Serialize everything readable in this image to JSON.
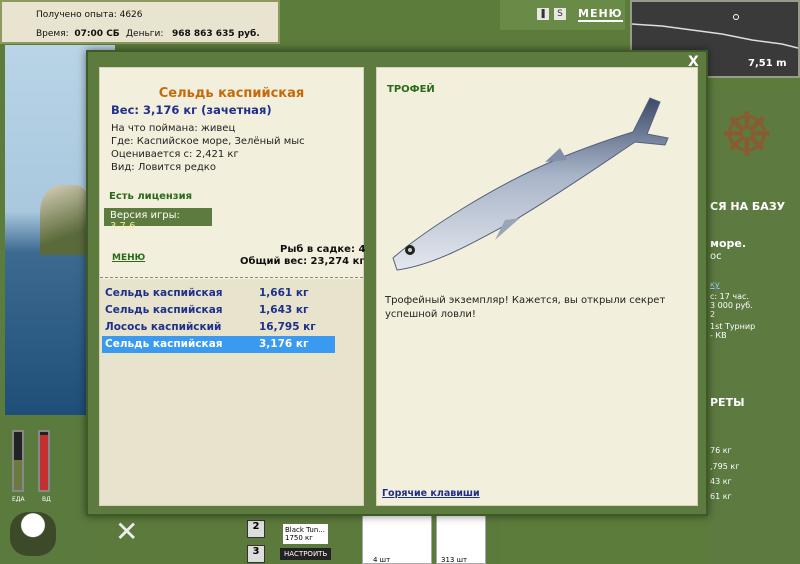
{
  "hud": {
    "experience": "Получено опыта: 4626",
    "time_label": "Время:",
    "time_value": "07:00 СБ",
    "money_label": "Деньги:",
    "money_value": "968 863 635 руб.",
    "menu": "МЕНЮ",
    "depth": "7,51 m",
    "eda": "ЕДА",
    "vd": "ВД"
  },
  "background": {
    "to_base": "СЯ НА БАЗУ",
    "sea_title": "море.",
    "sea_sub": "ос",
    "link": "ку",
    "lines": [
      "с: 17 час.",
      "3 000 руб.",
      "2",
      "1st Турнир",
      "- КВ"
    ],
    "secrets": "РЕТЫ",
    "weights": [
      "76 кг",
      ",795 кг",
      "43 кг",
      "61 кг"
    ],
    "bottom_fish": "Black Tun...",
    "bottom_weight": "1750 кг",
    "bottom_button": "НАСТРОИТЬ",
    "slot_numbers": [
      "2",
      "3"
    ],
    "counts": [
      "4 шт",
      "313 шт"
    ]
  },
  "dialog": {
    "close": "X",
    "fish_name": "Сельдь каспийская",
    "weight": "Вес: 3,176 кг (зачетная)",
    "caught_on": "На что поймана: живец",
    "location": "Где: Каспийское море, Зелёный мыс",
    "price": "Оценивается с: 2,421 кг",
    "kind": "Вид: Ловится редко",
    "license": "Есть лицензия",
    "version_label": "Версия игры:",
    "version_value": "3.7.6",
    "menu": "МЕНЮ",
    "keepnet_count": "Рыб в садке: 4",
    "keepnet_weight": "Общий вес: 23,274 кг",
    "catches": [
      {
        "name": "Сельдь каспийская",
        "weight": "1,661 кг"
      },
      {
        "name": "Сельдь каспийская",
        "weight": "1,643 кг"
      },
      {
        "name": "Лосось каспийский",
        "weight": "16,795 кг"
      },
      {
        "name": "Сельдь каспийская",
        "weight": "3,176 кг"
      }
    ],
    "trophy_title": "ТРОФЕЙ",
    "trophy_text": "Трофейный экземпляр! Кажется, вы открыли секрет успешной ловли!",
    "hotkeys": "Горячие клавиши"
  },
  "colors": {
    "accent_green": "#5d7b3e",
    "selection": "#3a9af0",
    "title_orange": "#c46a0c",
    "text_blue": "#1f2f8a"
  }
}
